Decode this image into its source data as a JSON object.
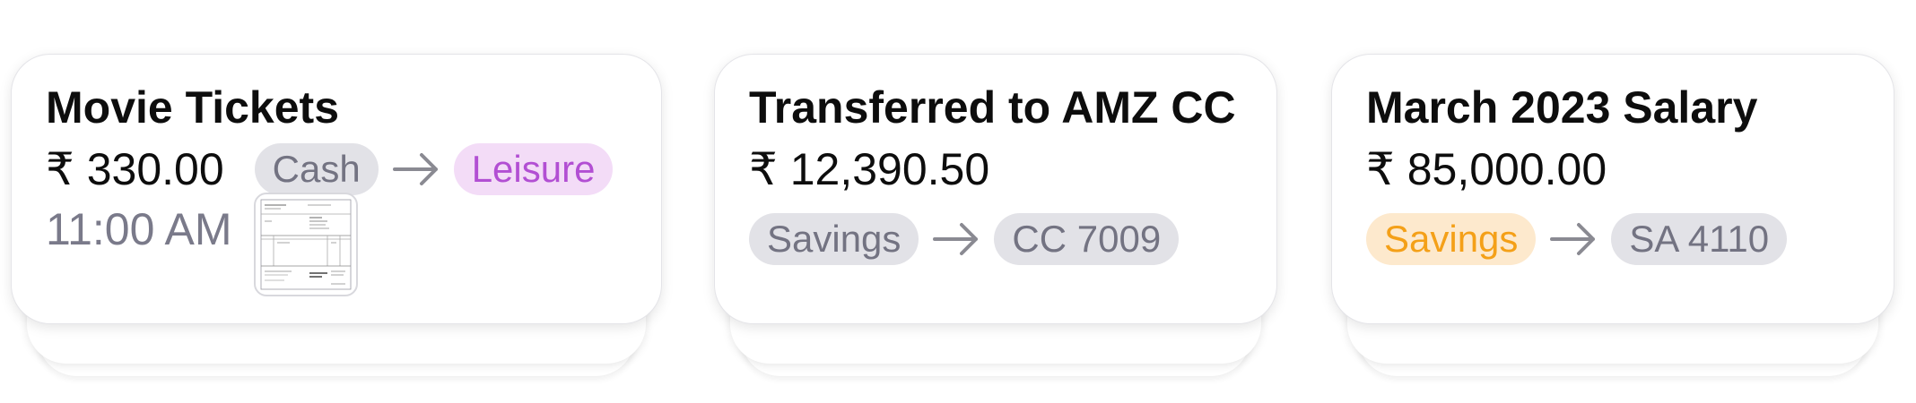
{
  "cards": [
    {
      "title": "Movie Tickets",
      "amount": "₹ 330.00",
      "from": "Cash",
      "to": "Leisure",
      "time": "11:00 AM",
      "attachment_icon": "receipt-thumbnail"
    },
    {
      "title": "Transferred to AMZ CC",
      "amount": "₹ 12,390.50",
      "from": "Savings",
      "to": "CC 7009"
    },
    {
      "title": "March 2023 Salary",
      "amount": "₹ 85,000.00",
      "from": "Savings",
      "to": "SA 4110"
    }
  ],
  "colors": {
    "pill_gray_bg": "#e2e2e7",
    "pill_gray_text": "#737382",
    "pill_purple_bg": "#f3dcf7",
    "pill_purple_text": "#b24fd3",
    "pill_orange_bg": "#fde9cd",
    "pill_orange_text": "#f4a018",
    "arrow": "#8a8a92"
  },
  "icons": {
    "arrow": "arrow-right-icon"
  }
}
